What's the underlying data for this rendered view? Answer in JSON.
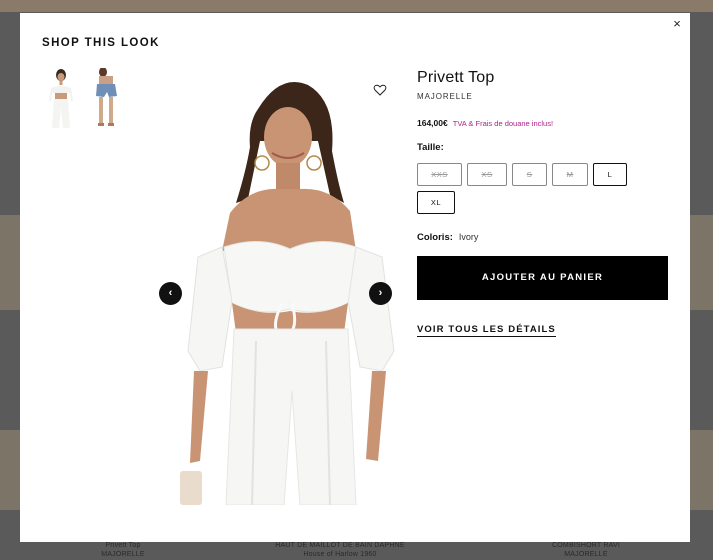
{
  "background": {
    "captions": [
      {
        "line1": "Privett Top",
        "line2": "MAJORELLE"
      },
      {
        "line1": "HAUT DE MAILLOT DE BAIN DAPHNE",
        "line2": "House of Harlow 1960"
      },
      {
        "line1": "COMBISHORT RAVI",
        "line2": "MAJORELLE"
      }
    ]
  },
  "modal": {
    "title": "SHOP THIS LOOK",
    "close_icon": "×",
    "thumbnails": [
      {
        "icon": "model-top-thumbnail"
      },
      {
        "icon": "model-shorts-thumbnail"
      }
    ],
    "prev_arrow": "‹",
    "next_arrow": "›",
    "wishlist_icon": "heart-outline-icon"
  },
  "product": {
    "name": "Privett Top",
    "brand": "MAJORELLE",
    "price": "164,00€",
    "tax_note": "TVA & Frais de douane inclus!",
    "size_label": "Taille:",
    "sizes": [
      {
        "label": "XXS",
        "available": false
      },
      {
        "label": "XS",
        "available": false
      },
      {
        "label": "S",
        "available": false
      },
      {
        "label": "M",
        "available": false
      },
      {
        "label": "L",
        "available": true
      },
      {
        "label": "XL",
        "available": true
      }
    ],
    "color_label": "Coloris:",
    "color_value": "Ivory",
    "add_to_cart": "AJOUTER AU PANIER",
    "details_link": "VOIR TOUS LES DÉTAILS"
  },
  "colors": {
    "accent_pink": "#b0218a",
    "button_black": "#000000"
  }
}
